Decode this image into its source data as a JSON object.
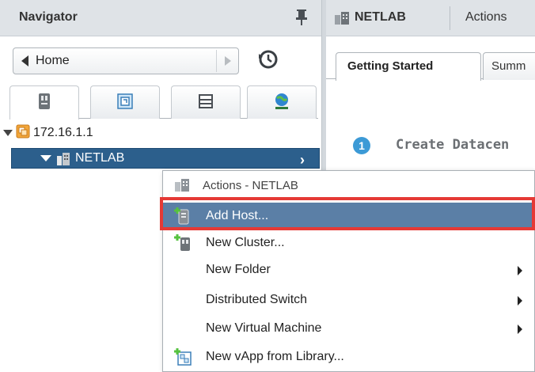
{
  "navigator": {
    "title": "Navigator",
    "breadcrumb": {
      "label": "Home"
    },
    "tree": {
      "host": "172.16.1.1",
      "datacenter": "NETLAB"
    }
  },
  "right_panel": {
    "header_title": "NETLAB",
    "header_actions": "Actions",
    "tabs": {
      "active": "Getting Started",
      "inactive": "Summ"
    },
    "step": {
      "number": "1",
      "text": "Create Datacen"
    }
  },
  "context_menu": {
    "header": "Actions - NETLAB",
    "items": [
      {
        "label": "Add Host...",
        "icon": "add-host-icon"
      },
      {
        "label": "New Cluster...",
        "icon": "new-cluster-icon"
      },
      {
        "label": "New Folder",
        "icon": ""
      },
      {
        "label": "Distributed Switch",
        "icon": ""
      },
      {
        "label": "New Virtual Machine",
        "icon": ""
      },
      {
        "label": "New vApp from Library...",
        "icon": "new-vapp-icon"
      }
    ]
  },
  "colors": {
    "header_bg": "#dfe3e7",
    "selection_blue": "#2c5f8c",
    "menu_selected": "#5b7fa6",
    "highlight_red": "#e53935"
  }
}
